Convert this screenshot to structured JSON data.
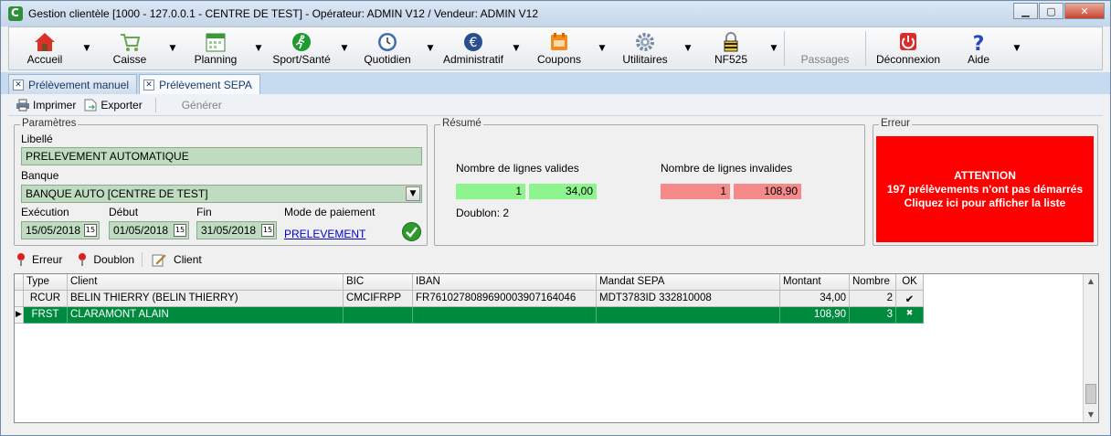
{
  "window": {
    "title": "Gestion clientèle [1000 - 127.0.0.1 - CENTRE DE TEST] - Opérateur: ADMIN V12 / Vendeur: ADMIN V12"
  },
  "toolbar": {
    "items": [
      {
        "label": "Accueil",
        "icon": "home-icon"
      },
      {
        "label": "Caisse",
        "icon": "cart-icon"
      },
      {
        "label": "Planning",
        "icon": "calendar-icon"
      },
      {
        "label": "Sport/Santé",
        "icon": "runner-icon"
      },
      {
        "label": "Quotidien",
        "icon": "clock-icon"
      },
      {
        "label": "Administratif",
        "icon": "euro-icon"
      },
      {
        "label": "Coupons",
        "icon": "coupon-icon"
      },
      {
        "label": "Utilitaires",
        "icon": "gear-icon"
      },
      {
        "label": "NF525",
        "icon": "lock-icon"
      },
      {
        "label": "Passages",
        "icon": ""
      },
      {
        "label": "Déconnexion",
        "icon": "power-icon"
      },
      {
        "label": "Aide",
        "icon": "help-icon"
      }
    ]
  },
  "tabs": [
    {
      "label": "Prélèvement manuel"
    },
    {
      "label": "Prélèvement SEPA"
    }
  ],
  "actions": {
    "print": "Imprimer",
    "export": "Exporter",
    "generate": "Générer"
  },
  "params": {
    "title": "Paramètres",
    "libelle_label": "Libellé",
    "libelle_value": "PRELEVEMENT AUTOMATIQUE",
    "banque_label": "Banque",
    "banque_value": "BANQUE AUTO [CENTRE DE TEST]",
    "execution_label": "Exécution",
    "execution_value": "15/05/2018",
    "debut_label": "Début",
    "debut_value": "01/05/2018",
    "fin_label": "Fin",
    "fin_value": "31/05/2018",
    "mode_label": "Mode de paiement",
    "mode_value": "PRELEVEMENT"
  },
  "resume": {
    "title": "Résumé",
    "valid_label": "Nombre de lignes valides",
    "valid_count": "1",
    "valid_amount": "34,00",
    "invalid_label": "Nombre de lignes invalides",
    "invalid_count": "1",
    "invalid_amount": "108,90",
    "doublon": "Doublon: 2"
  },
  "erreur": {
    "title": "Erreur",
    "line1": "ATTENTION",
    "line2": "197 prélèvements n'ont pas démarrés",
    "line3": "Cliquez ici pour afficher la liste"
  },
  "filters": {
    "erreur": "Erreur",
    "doublon": "Doublon",
    "client": "Client"
  },
  "grid": {
    "columns": [
      "Type",
      "Client",
      "BIC",
      "IBAN",
      "Mandat SEPA",
      "Montant",
      "Nombre",
      "OK"
    ],
    "rows": [
      [
        "RCUR",
        "BELIN THIERRY (BELIN THIERRY)",
        "CMCIFRPP",
        "FR7610278089690003907164046",
        "MDT3783ID 332810008",
        "34,00",
        "2",
        "✔"
      ],
      [
        "FRST",
        "CLARAMONT ALAIN",
        "",
        "",
        "",
        "108,90",
        "3",
        "✖"
      ]
    ]
  },
  "colors": {
    "valid": "#8ef58e",
    "invalid": "#f58a8a",
    "alert": "#ff0000",
    "selected_row": "#008a3e",
    "field": "#c0dcc0"
  }
}
